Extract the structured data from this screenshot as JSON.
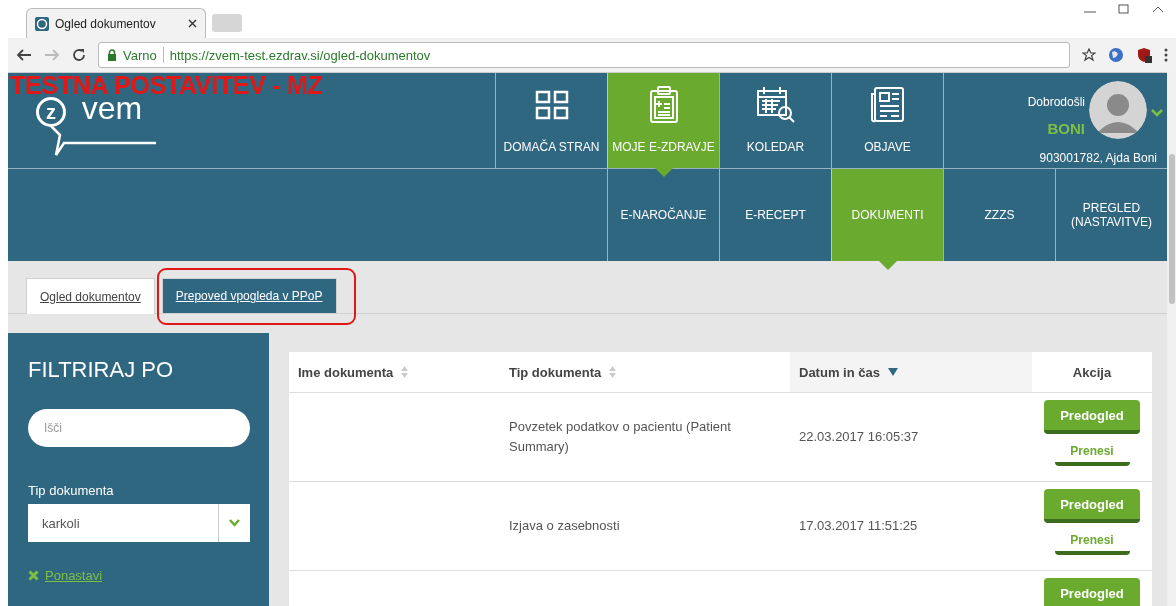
{
  "browser": {
    "tab_title": "Ogled dokumentov",
    "security_label": "Varno",
    "url": "https://zvem-test.ezdrav.si/ogled-dokumentov"
  },
  "banner": "TESTNA POSTAVITEV - MZ",
  "logo": {
    "mark": "z",
    "text": "vem"
  },
  "main_nav": [
    {
      "kind": "home",
      "label": "DOMAČA STRAN",
      "selected": false
    },
    {
      "kind": "health",
      "label": "MOJE E-ZDRAVJE",
      "selected": true
    },
    {
      "kind": "calendar",
      "label": "KOLEDAR",
      "selected": false
    },
    {
      "kind": "news",
      "label": "OBJAVE",
      "selected": false
    }
  ],
  "user": {
    "greeting": "Dobrodošli",
    "name": "BONI",
    "id": "903001782, Ajda Boni"
  },
  "sub_nav": [
    {
      "label": "E-NAROČANJE",
      "selected": false
    },
    {
      "label": "E-RECEPT",
      "selected": false
    },
    {
      "label": "DOKUMENTI",
      "selected": true
    },
    {
      "label": "ZZZS",
      "selected": false
    },
    {
      "label": "PREGLED (NASTAVITVE)",
      "selected": false
    }
  ],
  "page_tabs": [
    {
      "label": "Ogled dokumentov",
      "selected": true,
      "highlighted": false
    },
    {
      "label": "Prepoved vpogleda v PPoP",
      "selected": false,
      "highlighted": true
    }
  ],
  "sidebar": {
    "title": "FILTRIRAJ PO",
    "search": {
      "placeholder": "Išči"
    },
    "filter_label": "Tip dokumenta",
    "filter_value": "karkoli",
    "reset": "Ponastavi"
  },
  "table": {
    "columns": [
      {
        "label": "Ime dokumenta",
        "sortable": true,
        "sorted": false
      },
      {
        "label": "Tip dokumenta",
        "sortable": true,
        "sorted": false
      },
      {
        "label": "Datum in čas",
        "sortable": true,
        "sorted": true
      },
      {
        "label": "Akcija",
        "sortable": false
      }
    ],
    "rows": [
      {
        "type": "Povzetek podatkov o pacientu (Patient Summary)",
        "datetime": "22.03.2017 16:05:37",
        "preview": "Predogled",
        "download": "Prenesi"
      },
      {
        "type": "Izjava o zasebnosti",
        "datetime": "17.03.2017 11:51:25",
        "preview": "Predogled",
        "download": "Prenesi"
      },
      {
        "preview": "Predogled"
      }
    ]
  }
}
